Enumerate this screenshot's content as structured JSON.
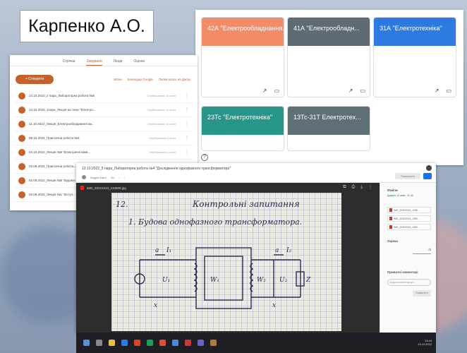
{
  "presenter": {
    "name": "Карпенко А.О."
  },
  "classroom": {
    "courses": [
      {
        "title": "42А \"Електрообладнання...",
        "color": "#f28b68"
      },
      {
        "title": "41А \"Електрообладн...",
        "color": "#5f6b72"
      },
      {
        "title": "31А \"Електротехніка\"",
        "color": "#2d7ae3"
      },
      {
        "title": "23Тс \"Електротехніка\"",
        "color": "#27958a"
      },
      {
        "title": "13Тс-31Т Електротех...",
        "color": "#5e6f76"
      }
    ]
  },
  "assignments": {
    "tabs": [
      "Стрічка",
      "Завдання",
      "Люди",
      "Оцінки"
    ],
    "create_label": "+ Створити",
    "toolbar": [
      "Мітки",
      "Календар Google",
      "Папка класу на Диску"
    ],
    "items": [
      {
        "title": "14.10.2022_2 пара_Лабораторна робота №5",
        "due": "Опубліковано 14 жовт."
      },
      {
        "title": "14.10.2022_1пара_Лекція на тему \"Електро...",
        "due": "Опубліковано 14 жовт."
      },
      {
        "title": "11.10.2022_Лекція_Електрообладнання ви...",
        "due": "Опубліковано 11 жовт."
      },
      {
        "title": "08.10.2022_Практична робота №3",
        "due": "Опубліковано 8 жовт."
      },
      {
        "title": "04.10.2022_Лекція №9 \"Електричні вимі...",
        "due": "Опубліковано 4 жовт."
      },
      {
        "title": "02.09.2022_Практична робота...",
        "due": "Опубліковано 2 вер."
      },
      {
        "title": "02.09.2022_Лекція №5 \"Будова...",
        "due": "Опубліковано 2 вер."
      },
      {
        "title": "02.09.2022_Лекція №1 \"Вступ...",
        "due": "Опубліковано 2 вер."
      }
    ]
  },
  "drive": {
    "doc_title": "13.10.2022_5 пара_Лабораторна робота №4 \"Дослідження однофазного трансформатора\"",
    "author": "Андрій Карп",
    "pager": "4/4",
    "open_label": "Повернути",
    "file_name": "IMG_20221013_134509.jpg",
    "side": {
      "header": "Файли",
      "sub": "Додано 13 жовт., 11:44",
      "files": [
        "IMG_20221013_1345...",
        "IMG_20221013_1350...",
        "IMG_20221013_1352..."
      ],
      "grade_label": "Оцінка",
      "grade_value": "/5",
      "comment_label": "Приватні коментарі",
      "comment_placeholder": "Додати коментар до...",
      "return_label": "Повернути"
    }
  },
  "sketch": {
    "number": "12.",
    "title": "Контрольні запитання",
    "subtitle": "1. Будова однофазного трансформатора.",
    "labels": [
      "a",
      "I₁",
      "a",
      "I₂",
      "U₁",
      "W₁",
      "W₂",
      "U₂",
      "Z",
      "x",
      "x"
    ]
  },
  "taskbar": {
    "time": "13:44",
    "date": "13.10.2022"
  }
}
